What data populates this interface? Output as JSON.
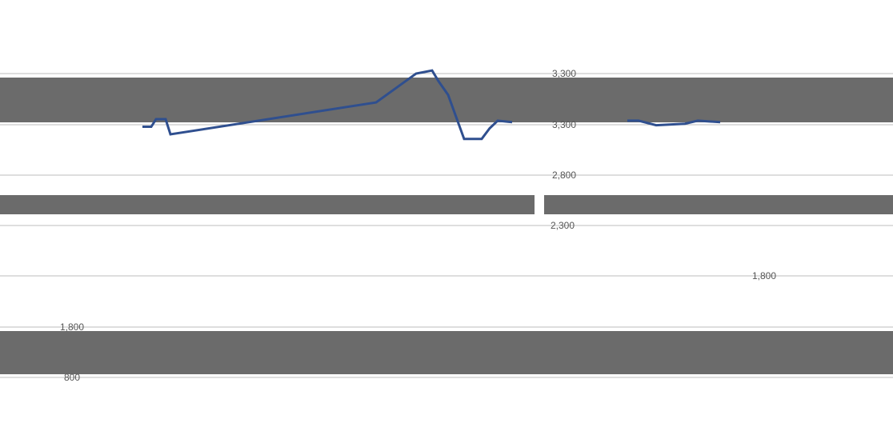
{
  "chart_data": {
    "type": "line",
    "title": "",
    "xlabel": "",
    "ylabel": "",
    "grid": true,
    "legend": "none",
    "axis_upper": {
      "ticks": [
        3300,
        3300,
        2800,
        2300
      ],
      "tick_labels": [
        "3,300",
        "3,300",
        "2,800",
        "2,300"
      ]
    },
    "axis_lower": {
      "ticks": [
        1800,
        1800,
        800
      ],
      "tick_labels": [
        "1,800",
        "1,800",
        "800"
      ]
    },
    "series": [
      {
        "color": "#2f4f8f",
        "values_upper_axis": [
          [
            178,
            2950
          ],
          [
            189,
            2950
          ],
          [
            195,
            3000
          ],
          [
            207,
            3000
          ],
          [
            213,
            2900
          ],
          [
            470,
            3110
          ],
          [
            520,
            3300
          ],
          [
            540,
            3320
          ],
          [
            548,
            3250
          ],
          [
            560,
            3160
          ],
          [
            580,
            2870
          ],
          [
            602,
            2870
          ],
          [
            612,
            2940
          ],
          [
            622,
            2990
          ],
          [
            640,
            2980
          ]
        ],
        "values_lower_axis": [
          [
            784,
            2990
          ],
          [
            798,
            2990
          ],
          [
            820,
            2960
          ],
          [
            856,
            2970
          ],
          [
            872,
            2990
          ],
          [
            900,
            2980
          ]
        ]
      }
    ]
  }
}
